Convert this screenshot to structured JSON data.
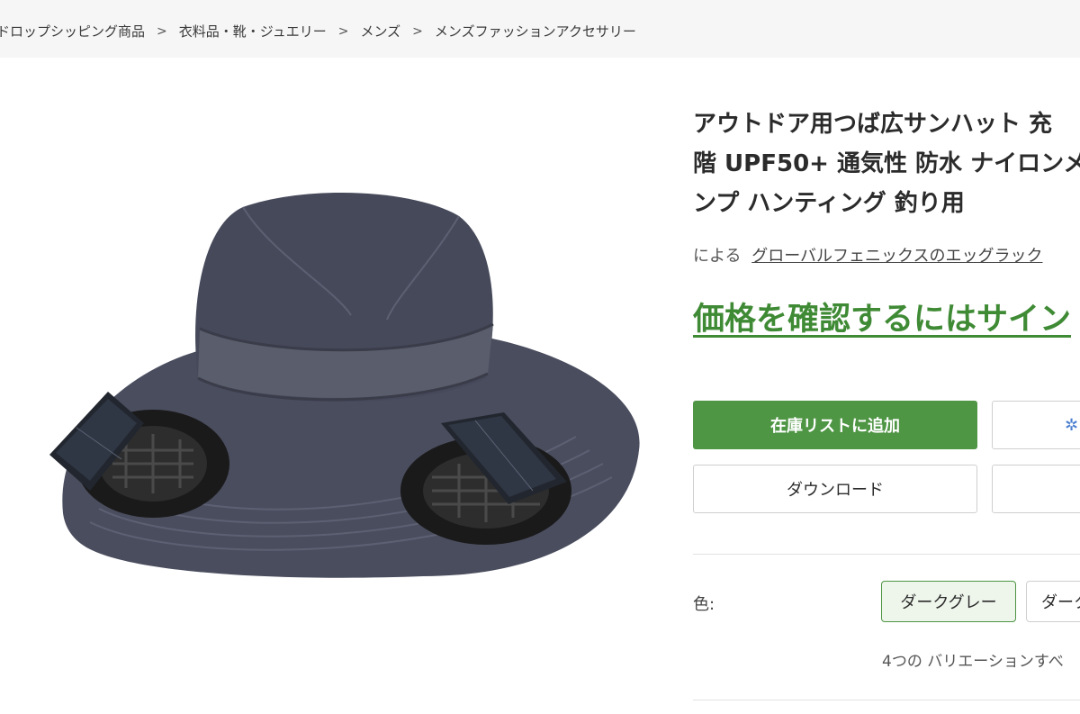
{
  "breadcrumb": {
    "items": [
      "ドロップシッピング商品",
      "衣料品・靴・ジュエリー",
      "メンズ",
      "メンズファッションアクセサリー"
    ],
    "separator": ">"
  },
  "product": {
    "title_lines": [
      "アウトドア用つば広サンハット 充",
      "階 UPF50+ 通気性 防水 ナイロンメ",
      "ンプ ハンティング 釣り用"
    ],
    "by_label": "による",
    "seller": "グローバルフェニックスのエッグラック",
    "price_signin": "価格を確認するにはサイン",
    "image_icon": "fan-hat-image"
  },
  "actions": {
    "add_to_inventory": "在庫リストに追加",
    "download": "ダウンロード",
    "side_icon": "sparkle-icon",
    "side_icon_glyph": "✲"
  },
  "options": {
    "color_label": "色:",
    "colors": [
      "ダークグレー",
      "ダーク"
    ],
    "variations_text": "4つの バリエーションすべ"
  },
  "theme": {
    "accent": "#4e9544",
    "link_green": "#3f8a34"
  }
}
